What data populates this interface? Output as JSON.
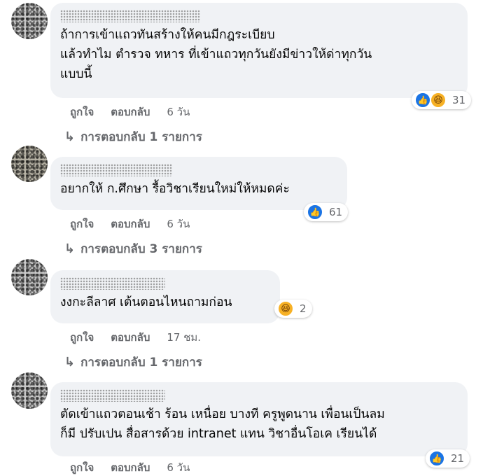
{
  "comments": [
    {
      "text": "ถ้าการเข้าแถวทันสร้างให้คนมีกฎระเบียบ\nแล้วทำไม ตำรวจ ทหาร ที่เข้าแถวทุกวันยังมีข่าวให้ด่าทุกวัน\nแบบนี้",
      "reaction_count": "31",
      "reactions": [
        "like-icon",
        "haha-icon"
      ],
      "actions": {
        "like": "ถูกใจ",
        "reply": "ตอบกลับ",
        "time": "6 วัน"
      },
      "replies": "การตอบกลับ 1 รายการ"
    },
    {
      "text": "อยากให้ ก.ศึกษา รื้อวิชาเรียนใหม่ให้หมดค่ะ",
      "reaction_count": "61",
      "reactions": [
        "like-icon"
      ],
      "actions": {
        "like": "ถูกใจ",
        "reply": "ตอบกลับ",
        "time": "6 วัน"
      },
      "replies": "การตอบกลับ 3 รายการ"
    },
    {
      "text": "งงกะลีลาศ เต้นตอนไหนถามก่อน",
      "reaction_count": "2",
      "reactions": [
        "haha-icon"
      ],
      "actions": {
        "like": "ถูกใจ",
        "reply": "ตอบกลับ",
        "time": "17 ชม."
      },
      "replies": "การตอบกลับ 1 รายการ"
    },
    {
      "text": "ตัดเข้าแถวตอนเช้า ร้อน เหนื่อย บางที ครูพูดนาน เพื่อนเป็นลม\nก็มี ปรับเปน สื่อสารด้วย intranet แทน วิชาอื่นโอเค เรียนได้",
      "reaction_count": "21",
      "reactions": [
        "like-icon"
      ],
      "actions": {
        "like": "ถูกใจ",
        "reply": "ตอบกลับ",
        "time": "6 วัน"
      }
    }
  ],
  "colors": {
    "bubble": "#f0f2f5",
    "like": "#1b74e4",
    "haha": "#f7b125",
    "secondary_text": "#65676b"
  }
}
